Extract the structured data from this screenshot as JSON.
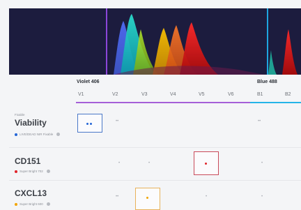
{
  "spectrum": {
    "background": "#1c1c3e",
    "peaks": [
      {
        "color": "#4f6cf5",
        "band": "violet"
      },
      {
        "color": "#12d0d8",
        "band": "violet"
      },
      {
        "color": "#a6e21a",
        "band": "violet"
      },
      {
        "color": "#f5b700",
        "band": "violet"
      },
      {
        "color": "#f06a1a",
        "band": "violet"
      },
      {
        "color": "#e31212",
        "band": "violet"
      },
      {
        "color": "#e31212",
        "band": "blue"
      }
    ]
  },
  "lasers": [
    {
      "name": "Violet 406",
      "color": "#a55fd8",
      "detectors": [
        "V1",
        "V2",
        "V3",
        "V4",
        "V5",
        "V6"
      ]
    },
    {
      "name": "Blue 488",
      "color": "#24b4e8",
      "detectors": [
        "B1",
        "B2"
      ]
    }
  ],
  "rows": [
    {
      "prefix": "Fixable",
      "marker": "Viability",
      "fluorochrome": "LIVE/DEAD NIR Fixable",
      "color": "#2566d6",
      "selected_detector": "V1",
      "selected_box_color": "#4a78c8"
    },
    {
      "prefix": "",
      "marker": "CD151",
      "fluorochrome": "Super Bright 702",
      "color": "#e0242a",
      "selected_detector": "V5",
      "selected_box_color": "#c94a5a"
    },
    {
      "prefix": "",
      "marker": "CXCL13",
      "fluorochrome": "Super Bright 600",
      "color": "#f2a400",
      "selected_detector": "V3",
      "selected_box_color": "#e8b25a"
    }
  ]
}
